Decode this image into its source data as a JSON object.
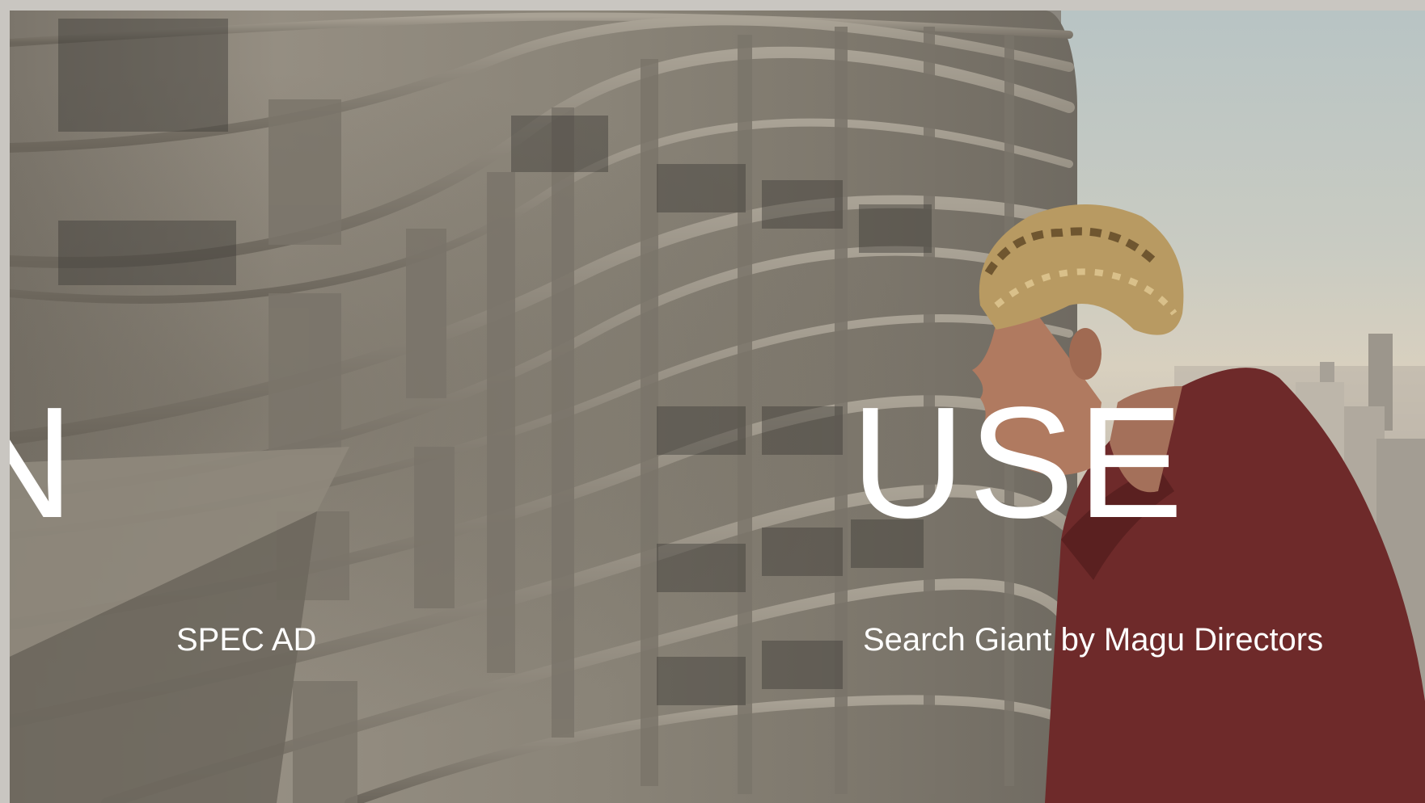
{
  "slide": {
    "headline_left_fragment": "N",
    "headline_right_fragment": "USE",
    "category_label": "SPEC AD",
    "project_credit": "Search Giant by Magu Directors"
  },
  "colors": {
    "frame_border": "#c9c6c1",
    "text": "#ffffff",
    "concrete": "#8b877f",
    "sky": "#c9cbc2",
    "hoodie": "#6e2a2a",
    "hair": "#b89a62"
  }
}
